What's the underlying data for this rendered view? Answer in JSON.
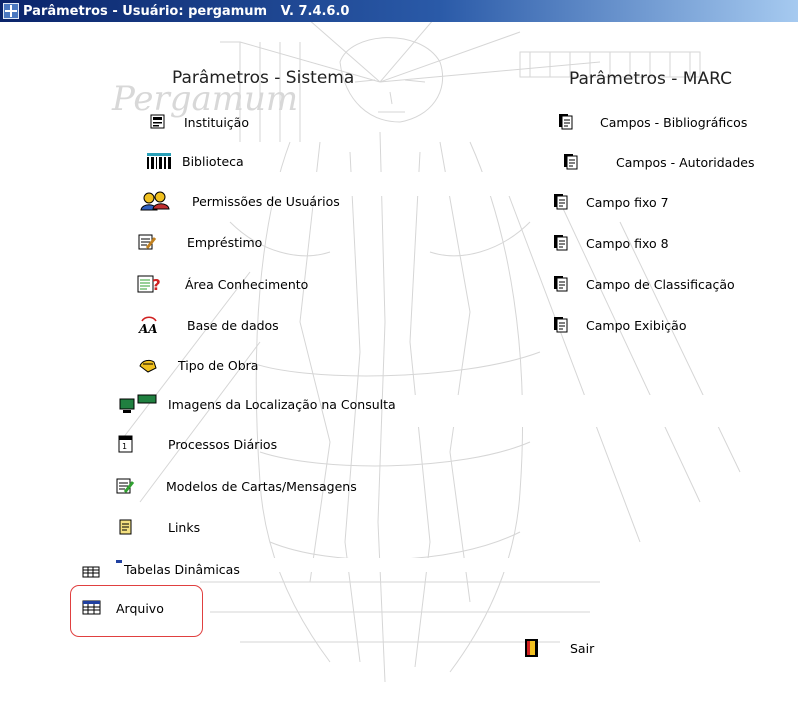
{
  "window": {
    "title": "Parâmetros - Usuário: pergamum   V. 7.4.6.0"
  },
  "watermark": "Pergamum",
  "sections": {
    "sistema": {
      "heading": "Parâmetros - Sistema",
      "items": [
        {
          "label": "Instituição",
          "icon": "institution-icon"
        },
        {
          "label": "Biblioteca",
          "icon": "library-barcode-icon"
        },
        {
          "label": "Permissões de Usuários",
          "icon": "users-icon"
        },
        {
          "label": "Empréstimo",
          "icon": "document-pen-icon"
        },
        {
          "label": "Área Conhecimento",
          "icon": "help-document-icon"
        },
        {
          "label": "Base de dados",
          "icon": "database-aa-icon"
        },
        {
          "label": "Tipo de Obra",
          "icon": "hand-book-icon"
        },
        {
          "label": "Imagens da Localização na Consulta",
          "icon": "monitor-icon"
        },
        {
          "label": "Processos Diários",
          "icon": "calendar-icon"
        },
        {
          "label": "Modelos de Cartas/Mensagens",
          "icon": "letter-icon"
        },
        {
          "label": "Links",
          "icon": "links-icon"
        },
        {
          "label": "Tabelas Dinâmicas",
          "icon": "table-icon"
        },
        {
          "label": "Arquivo",
          "icon": "file-table-icon"
        }
      ]
    },
    "marc": {
      "heading": "Parâmetros - MARC",
      "items": [
        {
          "label": "Campos - Bibliográficos",
          "icon": "pages-icon"
        },
        {
          "label": "Campos - Autoridades",
          "icon": "pages-icon"
        },
        {
          "label": "Campo fixo 7",
          "icon": "pages-icon"
        },
        {
          "label": "Campo fixo 8",
          "icon": "pages-icon"
        },
        {
          "label": "Campo de Classificação",
          "icon": "pages-icon"
        },
        {
          "label": "Campo Exibição",
          "icon": "pages-icon"
        }
      ]
    }
  },
  "exit": {
    "label": "Sair",
    "icon": "exit-door-icon"
  },
  "colors": {
    "highlight": "#e04040",
    "titlebar": "#0a246a"
  }
}
